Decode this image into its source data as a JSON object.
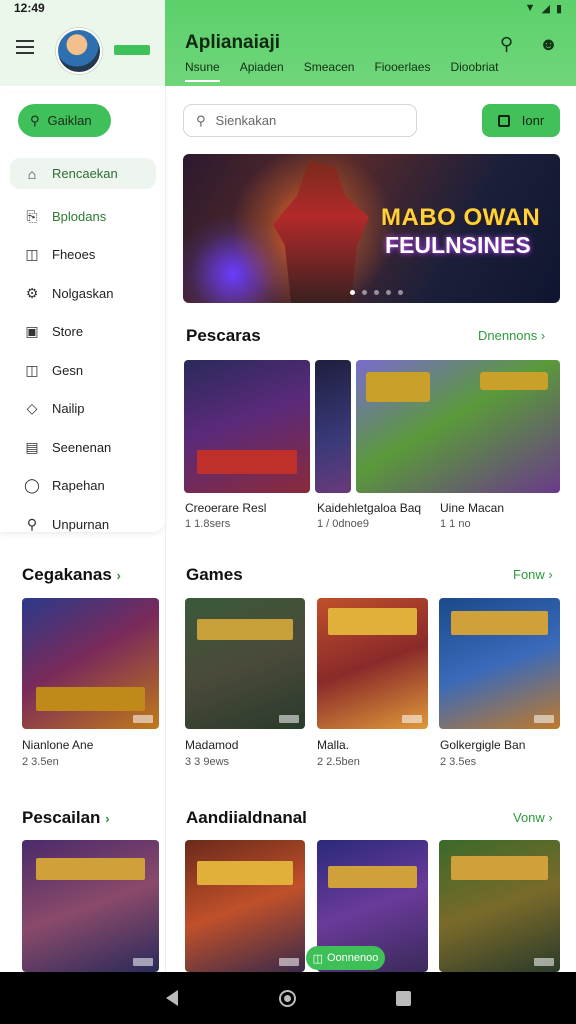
{
  "status": {
    "time": "12:49"
  },
  "app": {
    "title": "Aplianaiaji"
  },
  "tabs": [
    {
      "label": "Nsune"
    },
    {
      "label": "Apiaden"
    },
    {
      "label": "Smeacen"
    },
    {
      "label": "Fiooerlaes"
    },
    {
      "label": "Dioobriat"
    }
  ],
  "sidebar": {
    "search_label": "Gaiklan",
    "items": [
      {
        "label": "Rencaekan",
        "icon": "home-icon"
      },
      {
        "label": "Bplodans",
        "icon": "download-icon"
      },
      {
        "label": "Fheoes",
        "icon": "gamepad-icon"
      },
      {
        "label": "Nolgaskan",
        "icon": "settings-icon"
      },
      {
        "label": "Store",
        "icon": "store-icon"
      },
      {
        "label": "Gesn",
        "icon": "library-icon"
      },
      {
        "label": "Nailip",
        "icon": "tag-icon"
      },
      {
        "label": "Seenenan",
        "icon": "calendar-icon"
      },
      {
        "label": "Rapehan",
        "icon": "chat-icon"
      },
      {
        "label": "Unpurnan",
        "icon": "link-icon"
      }
    ]
  },
  "search": {
    "placeholder": "Sienkakan"
  },
  "action_button": {
    "label": "Ionr"
  },
  "hero": {
    "line1": "MABO OWAN",
    "line2": "FEULNSINES"
  },
  "section_popular": {
    "title": "Pescaras",
    "link": "Dnennons",
    "cards": [
      {
        "title": "Creoerare Resl",
        "sub": "1 1.8sers",
        "colors": [
          "#2a1f4a",
          "#6a3a8a",
          "#b0302a"
        ]
      },
      {
        "title": "Kaidehletgaloa Baq",
        "sub": "1 / 0dnoe9",
        "colors": [
          "#1a1a3a",
          "#3a3a7a",
          "#8a4a9a"
        ]
      },
      {
        "title": "Uine Macan",
        "sub": "1 1 no",
        "colors": [
          "#4a6a2a",
          "#8a3a7a",
          "#3a2a6a"
        ]
      }
    ]
  },
  "section_left1": {
    "title": "Cegakanas",
    "card": {
      "title": "Nianlone Ane",
      "sub": "2 3.5en"
    }
  },
  "section_left2": {
    "title": "Pescailan"
  },
  "section_games": {
    "title": "Games",
    "link": "Fonw",
    "cards": [
      {
        "title": "Madamod",
        "sub": "3 3 9ews"
      },
      {
        "title": "Malla.",
        "sub": "2 2.5ben"
      },
      {
        "title": "Golkergigle Ban",
        "sub": "2 3.5es"
      }
    ]
  },
  "section_recommended": {
    "title": "Aandiialdnanal",
    "link": "Vonw"
  },
  "float_button": {
    "label": "Oonnenoo"
  }
}
